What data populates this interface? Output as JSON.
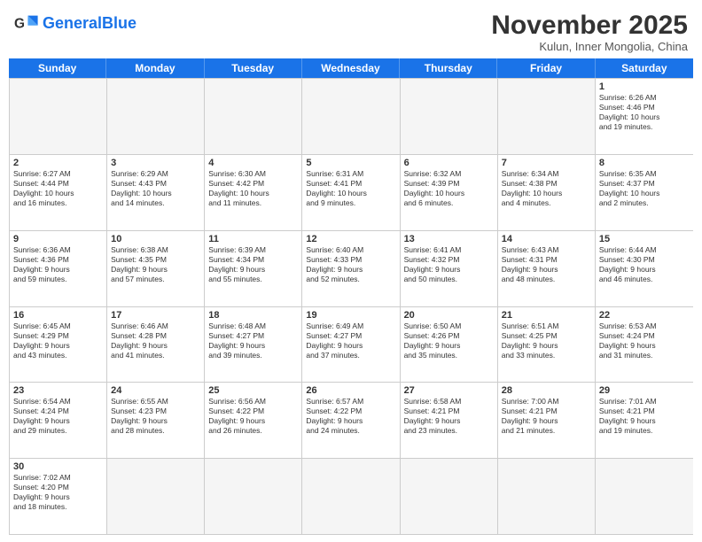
{
  "header": {
    "logo_general": "General",
    "logo_blue": "Blue",
    "month_title": "November 2025",
    "subtitle": "Kulun, Inner Mongolia, China"
  },
  "days_of_week": [
    "Sunday",
    "Monday",
    "Tuesday",
    "Wednesday",
    "Thursday",
    "Friday",
    "Saturday"
  ],
  "weeks": [
    [
      {
        "day": "",
        "empty": true
      },
      {
        "day": "",
        "empty": true
      },
      {
        "day": "",
        "empty": true
      },
      {
        "day": "",
        "empty": true
      },
      {
        "day": "",
        "empty": true
      },
      {
        "day": "",
        "empty": true
      },
      {
        "day": "1",
        "info": "Sunrise: 6:26 AM\nSunset: 4:46 PM\nDaylight: 10 hours\nand 19 minutes."
      }
    ],
    [
      {
        "day": "2",
        "info": "Sunrise: 6:27 AM\nSunset: 4:44 PM\nDaylight: 10 hours\nand 16 minutes."
      },
      {
        "day": "3",
        "info": "Sunrise: 6:29 AM\nSunset: 4:43 PM\nDaylight: 10 hours\nand 14 minutes."
      },
      {
        "day": "4",
        "info": "Sunrise: 6:30 AM\nSunset: 4:42 PM\nDaylight: 10 hours\nand 11 minutes."
      },
      {
        "day": "5",
        "info": "Sunrise: 6:31 AM\nSunset: 4:41 PM\nDaylight: 10 hours\nand 9 minutes."
      },
      {
        "day": "6",
        "info": "Sunrise: 6:32 AM\nSunset: 4:39 PM\nDaylight: 10 hours\nand 6 minutes."
      },
      {
        "day": "7",
        "info": "Sunrise: 6:34 AM\nSunset: 4:38 PM\nDaylight: 10 hours\nand 4 minutes."
      },
      {
        "day": "8",
        "info": "Sunrise: 6:35 AM\nSunset: 4:37 PM\nDaylight: 10 hours\nand 2 minutes."
      }
    ],
    [
      {
        "day": "9",
        "info": "Sunrise: 6:36 AM\nSunset: 4:36 PM\nDaylight: 9 hours\nand 59 minutes."
      },
      {
        "day": "10",
        "info": "Sunrise: 6:38 AM\nSunset: 4:35 PM\nDaylight: 9 hours\nand 57 minutes."
      },
      {
        "day": "11",
        "info": "Sunrise: 6:39 AM\nSunset: 4:34 PM\nDaylight: 9 hours\nand 55 minutes."
      },
      {
        "day": "12",
        "info": "Sunrise: 6:40 AM\nSunset: 4:33 PM\nDaylight: 9 hours\nand 52 minutes."
      },
      {
        "day": "13",
        "info": "Sunrise: 6:41 AM\nSunset: 4:32 PM\nDaylight: 9 hours\nand 50 minutes."
      },
      {
        "day": "14",
        "info": "Sunrise: 6:43 AM\nSunset: 4:31 PM\nDaylight: 9 hours\nand 48 minutes."
      },
      {
        "day": "15",
        "info": "Sunrise: 6:44 AM\nSunset: 4:30 PM\nDaylight: 9 hours\nand 46 minutes."
      }
    ],
    [
      {
        "day": "16",
        "info": "Sunrise: 6:45 AM\nSunset: 4:29 PM\nDaylight: 9 hours\nand 43 minutes."
      },
      {
        "day": "17",
        "info": "Sunrise: 6:46 AM\nSunset: 4:28 PM\nDaylight: 9 hours\nand 41 minutes."
      },
      {
        "day": "18",
        "info": "Sunrise: 6:48 AM\nSunset: 4:27 PM\nDaylight: 9 hours\nand 39 minutes."
      },
      {
        "day": "19",
        "info": "Sunrise: 6:49 AM\nSunset: 4:27 PM\nDaylight: 9 hours\nand 37 minutes."
      },
      {
        "day": "20",
        "info": "Sunrise: 6:50 AM\nSunset: 4:26 PM\nDaylight: 9 hours\nand 35 minutes."
      },
      {
        "day": "21",
        "info": "Sunrise: 6:51 AM\nSunset: 4:25 PM\nDaylight: 9 hours\nand 33 minutes."
      },
      {
        "day": "22",
        "info": "Sunrise: 6:53 AM\nSunset: 4:24 PM\nDaylight: 9 hours\nand 31 minutes."
      }
    ],
    [
      {
        "day": "23",
        "info": "Sunrise: 6:54 AM\nSunset: 4:24 PM\nDaylight: 9 hours\nand 29 minutes."
      },
      {
        "day": "24",
        "info": "Sunrise: 6:55 AM\nSunset: 4:23 PM\nDaylight: 9 hours\nand 28 minutes."
      },
      {
        "day": "25",
        "info": "Sunrise: 6:56 AM\nSunset: 4:22 PM\nDaylight: 9 hours\nand 26 minutes."
      },
      {
        "day": "26",
        "info": "Sunrise: 6:57 AM\nSunset: 4:22 PM\nDaylight: 9 hours\nand 24 minutes."
      },
      {
        "day": "27",
        "info": "Sunrise: 6:58 AM\nSunset: 4:21 PM\nDaylight: 9 hours\nand 23 minutes."
      },
      {
        "day": "28",
        "info": "Sunrise: 7:00 AM\nSunset: 4:21 PM\nDaylight: 9 hours\nand 21 minutes."
      },
      {
        "day": "29",
        "info": "Sunrise: 7:01 AM\nSunset: 4:21 PM\nDaylight: 9 hours\nand 19 minutes."
      }
    ],
    [
      {
        "day": "30",
        "info": "Sunrise: 7:02 AM\nSunset: 4:20 PM\nDaylight: 9 hours\nand 18 minutes."
      },
      {
        "day": "",
        "empty": true
      },
      {
        "day": "",
        "empty": true
      },
      {
        "day": "",
        "empty": true
      },
      {
        "day": "",
        "empty": true
      },
      {
        "day": "",
        "empty": true
      },
      {
        "day": "",
        "empty": true
      }
    ]
  ]
}
